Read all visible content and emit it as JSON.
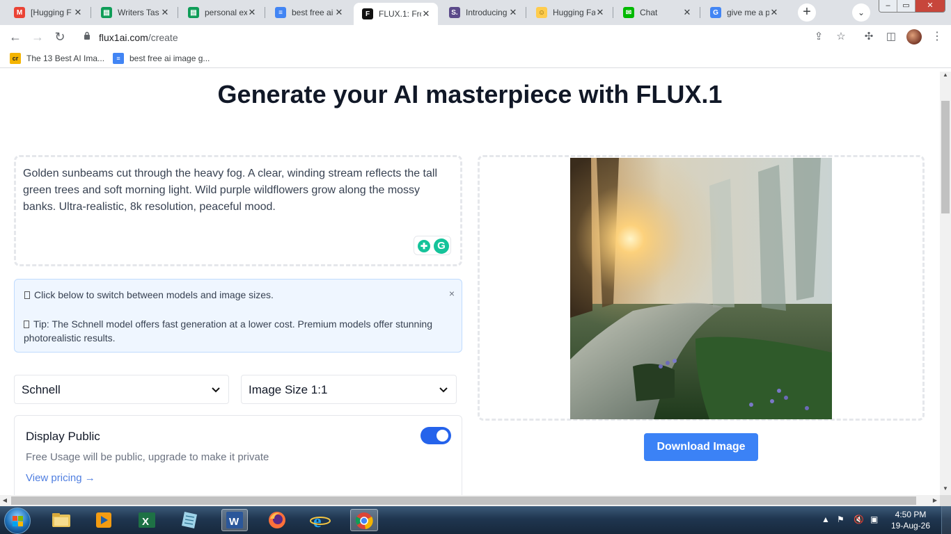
{
  "browser": {
    "tabs": [
      {
        "title": "[Hugging F",
        "icon": "gmail-icon",
        "color": "#ea4335",
        "letter": "M"
      },
      {
        "title": "Writers Tas",
        "icon": "sheets-icon",
        "color": "#0f9d58",
        "letter": "▤"
      },
      {
        "title": "personal ex",
        "icon": "sheets-icon",
        "color": "#0f9d58",
        "letter": "▤"
      },
      {
        "title": "best free ai",
        "icon": "docs-icon",
        "color": "#4285f4",
        "letter": "≡"
      },
      {
        "title": "FLUX.1: Fro",
        "icon": "flux-icon",
        "color": "#111111",
        "letter": "F"
      },
      {
        "title": "Introducing",
        "icon": "s-icon",
        "color": "#5b4a8a",
        "letter": "S."
      },
      {
        "title": "Hugging Fa",
        "icon": "hugging-face-icon",
        "color": "#ffcc4d",
        "letter": "☺"
      },
      {
        "title": "Chat",
        "icon": "chat-icon",
        "color": "#00b900",
        "letter": "✉"
      },
      {
        "title": "give me a p",
        "icon": "google-icon",
        "color": "#4285f4",
        "letter": "G"
      }
    ],
    "active_tab_index": 4,
    "url_host": "flux1ai.com",
    "url_path": "/create",
    "bookmarks": [
      {
        "label": "The 13 Best AI Ima...",
        "icon": "cr-icon",
        "icon_text": "cr"
      },
      {
        "label": "best free ai image g...",
        "icon": "docs-icon",
        "icon_text": "≡"
      }
    ]
  },
  "page": {
    "title": "Generate your AI masterpiece with FLUX.1",
    "prompt": " Golden sunbeams cut through the heavy fog. A clear, winding stream reflects the tall green trees and soft morning light. Wild purple wildflowers grow along the mossy banks. Ultra-realistic, 8k resolution, peaceful mood.",
    "tip_line_1": "Click below to switch between models and image sizes.",
    "tip_line_2": "Tip: The Schnell model offers fast generation at a lower cost. Premium models offer stunning photorealistic results.",
    "tip_close": "×",
    "model_select": "Schnell",
    "size_select": "Image Size 1:1",
    "display_public_title": "Display Public",
    "display_public_desc": "Free Usage will be public, upgrade to make it private",
    "display_public_on": true,
    "view_pricing": "View pricing →",
    "download_button": "Download Image"
  },
  "taskbar": {
    "time": "4:50 PM",
    "date": "19-Aug-26",
    "apps": [
      "file-explorer-icon",
      "media-player-icon",
      "excel-icon",
      "notepad-icon",
      "word-icon",
      "firefox-icon",
      "internet-explorer-icon",
      "chrome-icon"
    ],
    "active_app": "chrome-icon"
  },
  "colors": {
    "accent": "#3b82f6",
    "toggle_on": "#2563eb",
    "tip_bg": "#eff6ff"
  }
}
